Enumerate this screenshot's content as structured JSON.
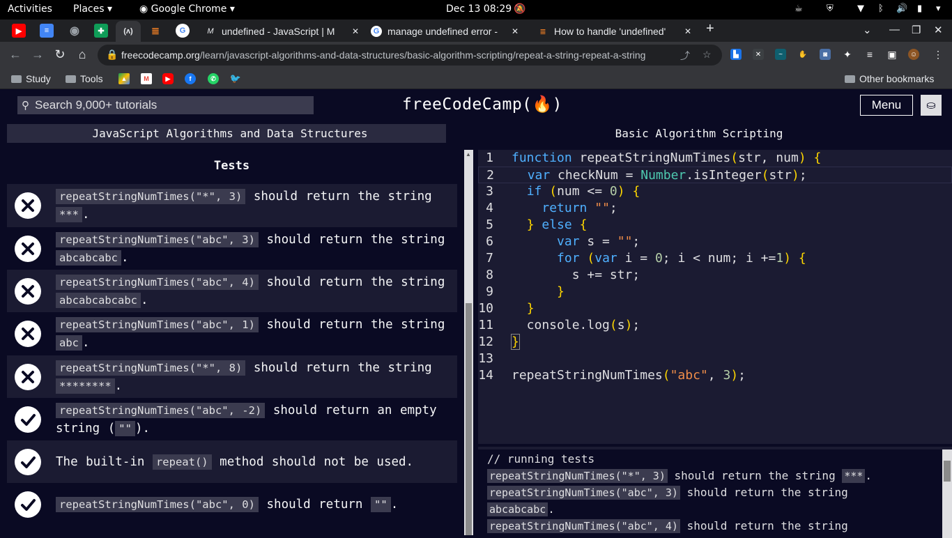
{
  "system_bar": {
    "activities": "Activities",
    "places": "Places",
    "app": "Google Chrome",
    "datetime": "Dec 13  08:29"
  },
  "tabs": [
    {
      "title": "undefined - JavaScript | M",
      "favicon": "mdn-icon"
    },
    {
      "title": "manage undefined error - ",
      "favicon": "google-icon"
    },
    {
      "title": "How to handle 'undefined'",
      "favicon": "stackoverflow-icon"
    }
  ],
  "omnibox": {
    "host": "freecodecamp.org",
    "path": "/learn/javascript-algorithms-and-data-structures/basic-algorithm-scripting/repeat-a-string-repeat-a-string"
  },
  "bookmarks": {
    "study": "Study",
    "tools": "Tools",
    "other": "Other bookmarks"
  },
  "fcc": {
    "search_placeholder": "Search 9,000+ tutorials",
    "logo": "freeCodeCamp(🔥)",
    "menu": "Menu",
    "crumb1": "JavaScript Algorithms and Data Structures",
    "crumb2": "Basic Algorithm Scripting",
    "tests_heading": "Tests"
  },
  "tests": [
    {
      "status": "fail",
      "code": "repeatStringNumTimes(\"*\", 3)",
      "text": " should return the string ",
      "code2": "***",
      "end": "."
    },
    {
      "status": "fail",
      "code": "repeatStringNumTimes(\"abc\", 3)",
      "text": " should return the string ",
      "code2": "abcabcabc",
      "end": "."
    },
    {
      "status": "fail",
      "code": "repeatStringNumTimes(\"abc\", 4)",
      "text": " should return the string ",
      "code2": "abcabcabcabc",
      "end": "."
    },
    {
      "status": "fail",
      "code": "repeatStringNumTimes(\"abc\", 1)",
      "text": " should return the string ",
      "code2": "abc",
      "end": "."
    },
    {
      "status": "fail",
      "code": "repeatStringNumTimes(\"*\", 8)",
      "text": " should return the string ",
      "code2": "********",
      "end": "."
    },
    {
      "status": "pass",
      "code": "repeatStringNumTimes(\"abc\", -2)",
      "text": " should return an empty string (",
      "code2": "\"\"",
      "end": ")."
    },
    {
      "status": "pass",
      "code": "",
      "text": "The built-in ",
      "code2": "repeat()",
      "end": " method should not be used."
    },
    {
      "status": "pass",
      "code": "repeatStringNumTimes(\"abc\", 0)",
      "text": " should return ",
      "code2": "\"\"",
      "end": "."
    }
  ],
  "editor": {
    "lines": [
      "function repeatStringNumTimes(str, num) {",
      "  var checkNum = Number.isInteger(str);",
      "  if (num <= 0) {",
      "    return \"\";",
      "  } else {",
      "      var s = \"\";",
      "      for (var i = 0; i < num; i +=1) {",
      "        s += str;",
      "      }",
      "  }",
      "  console.log(s);",
      "}",
      "",
      "repeatStringNumTimes(\"abc\", 3);"
    ]
  },
  "console": {
    "header": "// running tests",
    "lines": [
      {
        "code": "repeatStringNumTimes(\"*\", 3)",
        "text": " should return the string ",
        "code2": "***",
        "end": "."
      },
      {
        "code": "repeatStringNumTimes(\"abc\", 3)",
        "text": " should return the string",
        "code2": "",
        "end": ""
      },
      {
        "code": "",
        "text": "",
        "code2": "abcabcabc",
        "end": "."
      },
      {
        "code": "repeatStringNumTimes(\"abc\", 4)",
        "text": " should return the string",
        "code2": "",
        "end": ""
      }
    ]
  }
}
